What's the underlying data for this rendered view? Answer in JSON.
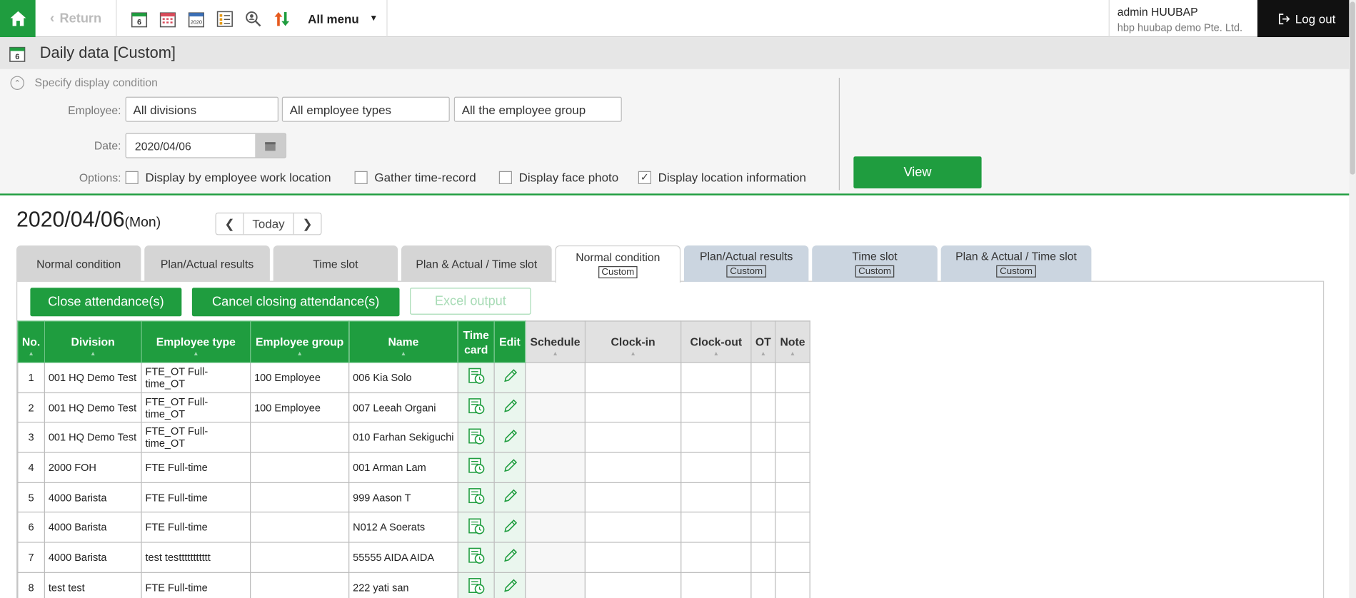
{
  "topbar": {
    "return_label": "Return",
    "all_menu_label": "All menu",
    "icons": [
      "daily-calendar-icon",
      "monthly-calendar-icon",
      "yearly-calendar-icon",
      "checklist-icon",
      "search-person-icon",
      "sort-arrows-icon"
    ],
    "calendar_day": "6",
    "calendar_year": "2020"
  },
  "user": {
    "name": "admin HUUBAP",
    "company": "hbp huubap demo Pte. Ltd."
  },
  "logout_label": "Log out",
  "page": {
    "title": "Daily data [Custom]"
  },
  "condition": {
    "title": "Specify display condition",
    "employee_label": "Employee:",
    "division": "All divisions",
    "employee_type": "All employee types",
    "employee_group": "All the employee group",
    "date_label": "Date:",
    "date_value": "2020/04/06",
    "options_label": "Options:",
    "options": [
      {
        "label": "Display by employee work location",
        "checked": false
      },
      {
        "label": "Gather time-record",
        "checked": false
      },
      {
        "label": "Display face photo",
        "checked": false
      },
      {
        "label": "Display location information",
        "checked": true
      }
    ],
    "view_label": "View"
  },
  "date_heading": {
    "date": "2020/04/06",
    "weekday": "(Mon)"
  },
  "nav": {
    "prev": "<",
    "today": "Today",
    "next": ">"
  },
  "tabs": [
    {
      "label": "Normal condition",
      "tag": ""
    },
    {
      "label": "Plan/Actual results",
      "tag": ""
    },
    {
      "label": "Time slot",
      "tag": ""
    },
    {
      "label": "Plan & Actual / Time slot",
      "tag": ""
    },
    {
      "label": "Normal condition",
      "tag": "Custom"
    },
    {
      "label": "Plan/Actual results",
      "tag": "Custom"
    },
    {
      "label": "Time slot",
      "tag": "Custom"
    },
    {
      "label": "Plan & Actual / Time slot",
      "tag": "Custom"
    }
  ],
  "actions": {
    "close": "Close attendance(s)",
    "cancel": "Cancel closing attendance(s)",
    "excel": "Excel output"
  },
  "table": {
    "headers": {
      "no": "No.",
      "division": "Division",
      "employee_type": "Employee type",
      "employee_group": "Employee group",
      "name": "Name",
      "time_card_1": "Time",
      "time_card_2": "card",
      "edit": "Edit",
      "schedule": "Schedule",
      "clock_in": "Clock-in",
      "clock_out": "Clock-out",
      "ot": "OT",
      "note": "Note"
    },
    "rows": [
      {
        "no": "1",
        "division": "001 HQ Demo Test",
        "employee_type": "FTE_OT Full-time_OT",
        "employee_group": "100 Employee",
        "name": "006 Kia Solo"
      },
      {
        "no": "2",
        "division": "001 HQ Demo Test",
        "employee_type": "FTE_OT Full-time_OT",
        "employee_group": "100 Employee",
        "name": "007 Leeah Organi"
      },
      {
        "no": "3",
        "division": "001 HQ Demo Test",
        "employee_type": "FTE_OT Full-time_OT",
        "employee_group": "",
        "name": "010 Farhan Sekiguchi"
      },
      {
        "no": "4",
        "division": "2000 FOH",
        "employee_type": "FTE Full-time",
        "employee_group": "",
        "name": "001 Arman Lam"
      },
      {
        "no": "5",
        "division": "4000 Barista",
        "employee_type": "FTE Full-time",
        "employee_group": "",
        "name": "999 Aason T"
      },
      {
        "no": "6",
        "division": "4000 Barista",
        "employee_type": "FTE Full-time",
        "employee_group": "",
        "name": "N012 A Soerats"
      },
      {
        "no": "7",
        "division": "4000 Barista",
        "employee_type": "test testtttttttttt",
        "employee_group": "",
        "name": "55555 AIDA AIDA"
      },
      {
        "no": "8",
        "division": "test test",
        "employee_type": "FTE Full-time",
        "employee_group": "",
        "name": "222 yati san"
      }
    ]
  },
  "colors": {
    "brand_green": "#1f9d3f",
    "custom_tab": "#cbd5e0"
  }
}
